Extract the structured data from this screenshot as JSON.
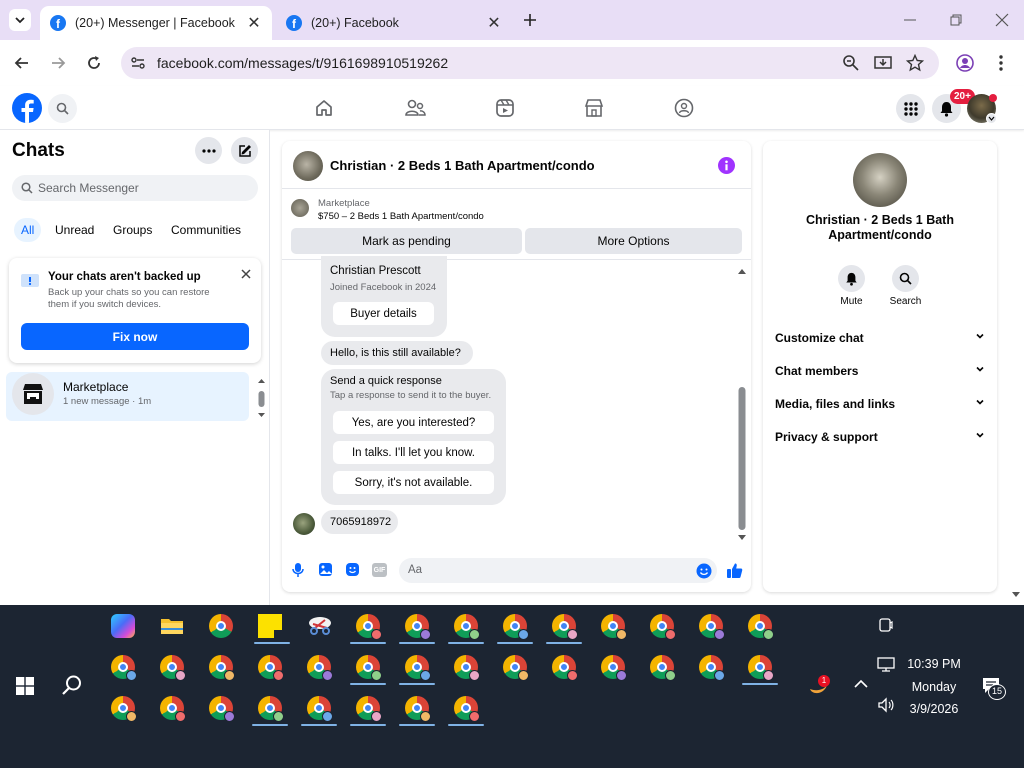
{
  "browser": {
    "tabs": [
      {
        "title": "(20+) Messenger | Facebook",
        "active": true
      },
      {
        "title": "(20+) Facebook",
        "active": false
      }
    ],
    "url": "facebook.com/messages/t/9161698910519262"
  },
  "header": {
    "notification_badge": "20+"
  },
  "sidebar": {
    "title": "Chats",
    "search_placeholder": "Search Messenger",
    "filters": [
      "All",
      "Unread",
      "Groups",
      "Communities"
    ],
    "backup_title": "Your chats aren't backed up",
    "backup_text": "Back up your chats so you can restore them if you switch devices.",
    "backup_button": "Fix now",
    "chats": [
      {
        "name": "Marketplace",
        "preview": "1 new message · 1m"
      }
    ]
  },
  "conversation": {
    "title": "Christian · 2 Beds 1 Bath Apartment/condo",
    "listing_source": "Marketplace",
    "listing": "$750 – 2 Beds 1 Bath Apartment/condo",
    "actions": [
      "Mark as pending",
      "More Options"
    ],
    "buyer_name": "Christian Prescott",
    "buyer_joined": "Joined Facebook in 2024",
    "buyer_details_button": "Buyer details",
    "message_1": "Hello, is this still available?",
    "quick_response_title": "Send a quick response",
    "quick_response_subtitle": "Tap a response to send it to the buyer.",
    "quick_responses": [
      "Yes, are you interested?",
      "In talks. I'll let you know.",
      "Sorry, it's not available."
    ],
    "message_2": "7065918972",
    "composer_placeholder": "Aa",
    "gif_label": "GIF"
  },
  "details": {
    "name": "Christian · 2 Beds 1 Bath Apartment/condo",
    "mute_label": "Mute",
    "search_label": "Search",
    "sections": [
      "Customize chat",
      "Chat members",
      "Media, files and links",
      "Privacy & support"
    ]
  },
  "taskbar": {
    "time": "10:39 PM",
    "day": "Monday",
    "date": "3/9/2026",
    "notification_count": "15",
    "weather_badge": "1"
  },
  "colors": {
    "fb_blue": "#0866ff",
    "purple_info": "#a033ff",
    "tab_strip": "#e8def6",
    "taskbar": "#1c2532"
  }
}
